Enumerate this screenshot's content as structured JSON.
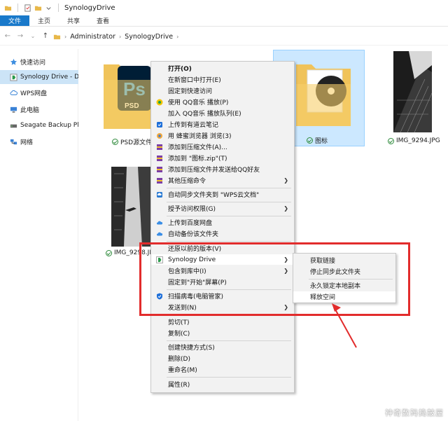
{
  "window": {
    "title": "SynologyDrive"
  },
  "ribbon": {
    "tabs": [
      "文件",
      "主页",
      "共享",
      "查看"
    ]
  },
  "breadcrumb": [
    "Administrator",
    "SynologyDrive"
  ],
  "nav": {
    "items": [
      {
        "label": "快速访问"
      },
      {
        "label": "Synology Drive - DS"
      },
      {
        "label": "WPS网盘"
      },
      {
        "label": "此电脑"
      },
      {
        "label": "Seagate Backup Plu"
      },
      {
        "label": "网络"
      }
    ]
  },
  "files": [
    {
      "name": "PSD源文件"
    },
    {
      "name": "图标"
    },
    {
      "name": "IMG_9294.JPG"
    },
    {
      "name": "IMG_9298.JPG"
    }
  ],
  "context_menu": {
    "open": "打开(O)",
    "open_new_window": "在新窗口中打开(E)",
    "pin_quick": "固定到快速访问",
    "qq_play": "使用 QQ音乐 播放(P)",
    "qq_queue": "加入 QQ音乐 播放队列(E)",
    "youdao": "上传到有道云笔记",
    "bee_browse": "用 蜂蜜浏览器 浏览(3)",
    "add_archive": "添加到压缩文件(A)...",
    "add_zip": "添加到 \"图标.zip\"(T)",
    "add_send_qq": "添加到压缩文件并发送给QQ好友",
    "other_compress": "其他压缩命令",
    "wps_sync": "自动同步文件夹到 \"WPS云文档\"",
    "grant_access": "授予访问权限(G)",
    "baidu": "上传到百度网盘",
    "auto_backup": "自动备份该文件夹",
    "restore": "还原以前的版本(V)",
    "synology": "Synology Drive",
    "include_lib": "包含到库中(I)",
    "pin_start": "固定到\"开始\"屏幕(P)",
    "virus_scan": "扫描病毒(电脑管家)",
    "send_to": "发送到(N)",
    "cut": "剪切(T)",
    "copy": "复制(C)",
    "shortcut": "创建快捷方式(S)",
    "delete": "删除(D)",
    "rename": "重命名(M)",
    "properties": "属性(R)"
  },
  "submenu": {
    "get_link": "获取链接",
    "stop_sync": "停止同步此文件夹",
    "pin_local": "永久锁定本地副本",
    "free_space": "释放空间"
  },
  "watermark": "神奇数码捣鼓屋",
  "colors": {
    "accent": "#1979ca",
    "highlight_box": "#e22c2c",
    "selection": "#cce8ff"
  }
}
